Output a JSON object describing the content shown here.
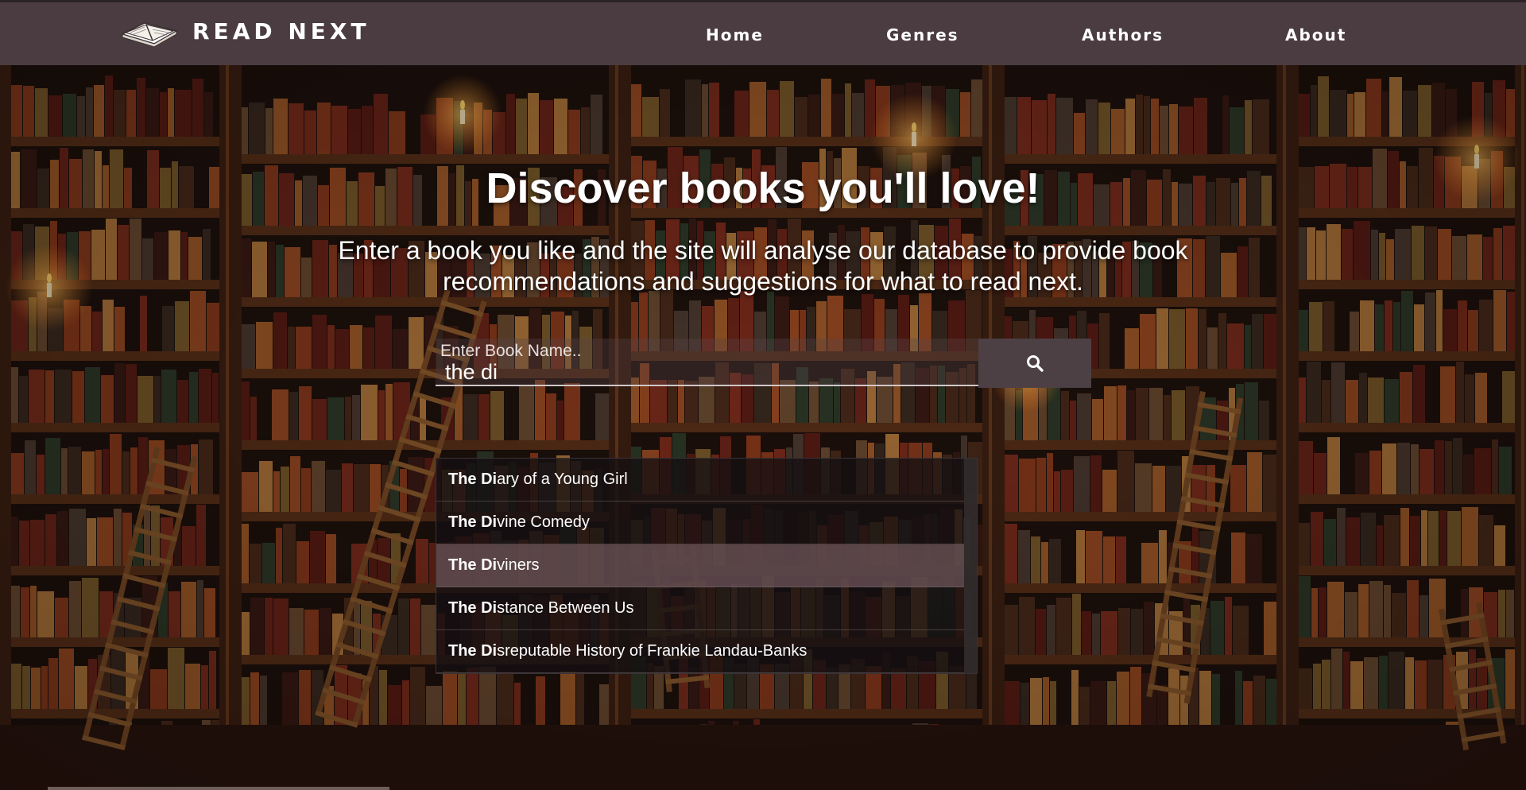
{
  "brand": {
    "name": "READ NEXT"
  },
  "nav": {
    "items": [
      {
        "label": "Home"
      },
      {
        "label": "Genres"
      },
      {
        "label": "Authors"
      },
      {
        "label": "About"
      }
    ]
  },
  "hero": {
    "title": "Discover books you'll love!",
    "subtitle": "Enter a book you like and the site will analyse our database to provide book recommendations and suggestions for what to read next."
  },
  "search": {
    "label": "Enter Book Name..",
    "value": "the di",
    "button_icon": "search-icon"
  },
  "autocomplete": {
    "items": [
      {
        "match": "The Di",
        "rest": "ary of a Young Girl",
        "active": false
      },
      {
        "match": "The Di",
        "rest": "vine Comedy",
        "active": false
      },
      {
        "match": "The Di",
        "rest": "viners",
        "active": true
      },
      {
        "match": "The Di",
        "rest": "stance Between Us",
        "active": false
      },
      {
        "match": "The Di",
        "rest": "sreputable History of Frankie Landau-Banks",
        "active": false
      }
    ]
  },
  "colors": {
    "navbar": "#4a3c40",
    "search_button": "#4d4044",
    "active_suggestion": "#6e565a",
    "text": "#ffffff"
  }
}
